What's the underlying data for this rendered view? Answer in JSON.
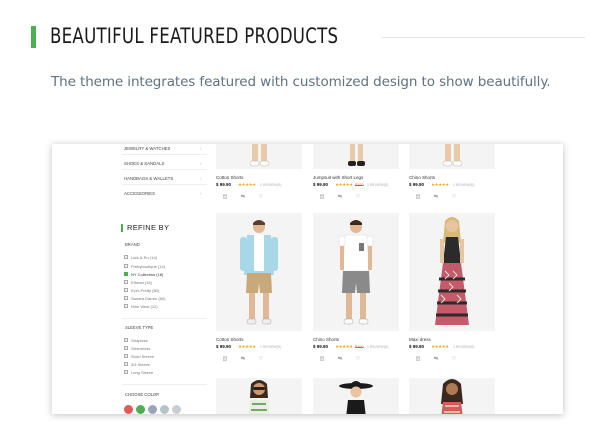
{
  "header": {
    "title": "BEAUTIFUL FEATURED PRODUCTS",
    "subtitle": "The theme integrates featured with customized design to show beautifully."
  },
  "sidebar": {
    "categories": [
      {
        "label": "JEWELRY & WATCHES"
      },
      {
        "label": "SHOES & SANDALS"
      },
      {
        "label": "HANDBAGS & WALLETS"
      },
      {
        "label": "ACCESSORIES"
      }
    ],
    "refine_title": "REFINE BY",
    "brand_label": "BRAND",
    "brands": [
      {
        "label": "Lark & Ro (14)",
        "checked": false
      },
      {
        "label": "Prettyboutique (14)",
        "checked": false
      },
      {
        "label": "NY Collection (18)",
        "checked": true
      },
      {
        "label": "Ethead (16)",
        "checked": false
      },
      {
        "label": "Ever-Pretty (80)",
        "checked": false
      },
      {
        "label": "Sandra Darren (80)",
        "checked": false
      },
      {
        "label": "Nine West (12)",
        "checked": false
      }
    ],
    "sleeve_label": "SLEEVE TYPE",
    "sleeves": [
      {
        "label": "Strapless"
      },
      {
        "label": "Sleeveless"
      },
      {
        "label": "Short Sleeve"
      },
      {
        "label": "3/4 Sleeve"
      },
      {
        "label": "Long Sleeve"
      }
    ],
    "color_label": "CHOOSE COLOR",
    "colors": [
      "#e05a5a",
      "#4caf50",
      "#9aa6b8",
      "#b8c4cc",
      "#c8ced4"
    ]
  },
  "products": [
    {
      "name": "Cotton Shorts",
      "price": "$ 99.90",
      "old": "",
      "rating": "★★★★★",
      "reviews": "1 REVIEW(S)"
    },
    {
      "name": "Jumpsuit with Short Legs",
      "price": "$ 99.90",
      "old": "$100",
      "rating": "★★★★★",
      "reviews": "1 REVIEW(S)"
    },
    {
      "name": "Chino Shorts",
      "price": "$ 99.90",
      "old": "",
      "rating": "★★★★★",
      "reviews": "1 REVIEW(S)"
    },
    {
      "name": "Cotton Shorts",
      "price": "$ 99.90",
      "old": "",
      "rating": "★★★★★",
      "reviews": "1 REVIEW(S)"
    },
    {
      "name": "Chino Shorts",
      "price": "$ 99.90",
      "old": "$100",
      "rating": "★★★★★",
      "reviews": "1 REVIEW(S)"
    },
    {
      "name": "Maxi dress",
      "price": "$ 99.90",
      "old": "",
      "rating": "★★★★★",
      "reviews": "1 REVIEW(S)"
    }
  ],
  "actions": {
    "cart_icon": "bag-icon",
    "compare_icon": "compare-icon",
    "wishlist_icon": "heart-icon",
    "cart_glyph": "◫",
    "compare_glyph": "⇋",
    "wishlist_glyph": "♡"
  }
}
